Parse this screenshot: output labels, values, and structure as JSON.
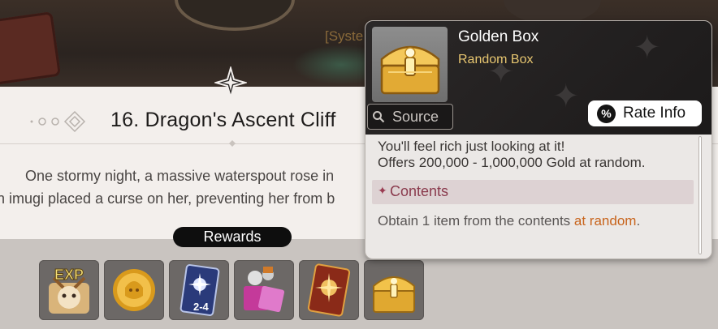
{
  "background": {
    "system_text": "[Syste"
  },
  "story": {
    "title": "16. Dragon's Ascent Cliff",
    "line1": "One stormy night, a massive waterspout rose in",
    "line2": "n imugi placed a curse on her, preventing her from b"
  },
  "rewards": {
    "label": "Rewards",
    "items": [
      {
        "icon": "exp-icon",
        "badge": "EXP"
      },
      {
        "icon": "gold-coin-icon"
      },
      {
        "icon": "summon-card-icon",
        "badge": "2-4"
      },
      {
        "icon": "gift-box-icon"
      },
      {
        "icon": "red-card-icon"
      },
      {
        "icon": "golden-chest-icon"
      }
    ]
  },
  "tooltip": {
    "item_name": "Golden Box",
    "item_type": "Random Box",
    "source_label": "Source",
    "rate_label": "Rate Info",
    "rate_icon": "%",
    "desc_line1": "You'll feel rich just looking at it!",
    "desc_line2": "Offers 200,000 - 1,000,000 Gold at random.",
    "contents_label": "Contents",
    "contents_star": "✦",
    "obtain_prefix": "Obtain 1 item from the contents ",
    "obtain_highlight": "at random",
    "obtain_suffix": "."
  },
  "colors": {
    "accent_gold": "#e7c670",
    "highlight_orange": "#c8641c",
    "contents_text": "#8a3a4d"
  }
}
